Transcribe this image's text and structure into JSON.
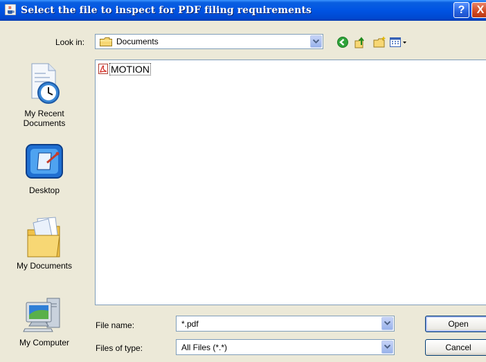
{
  "window": {
    "title": "Select the file to inspect for PDF filing requirements",
    "help_glyph": "?",
    "close_glyph": "X"
  },
  "look_in": {
    "label": "Look in:",
    "value": "Documents"
  },
  "places": [
    {
      "label_line1": "My Recent",
      "label_line2": "Documents",
      "icon": "recent-documents-icon"
    },
    {
      "label_line1": "Desktop",
      "label_line2": "",
      "icon": "desktop-icon"
    },
    {
      "label_line1": "My Documents",
      "label_line2": "",
      "icon": "my-documents-icon"
    },
    {
      "label_line1": "My Computer",
      "label_line2": "",
      "icon": "my-computer-icon"
    }
  ],
  "files": [
    {
      "name": "MOTION",
      "icon": "pdf-file-icon"
    }
  ],
  "file_name": {
    "label": "File name:",
    "value": "*.pdf"
  },
  "file_type": {
    "label": "Files of type:",
    "value": "All Files (*.*)"
  },
  "buttons": {
    "open": "Open",
    "cancel": "Cancel"
  },
  "colors": {
    "title_bar": "#0054e3",
    "dialog_bg": "#ece9d8",
    "close_button": "#d14a22"
  }
}
